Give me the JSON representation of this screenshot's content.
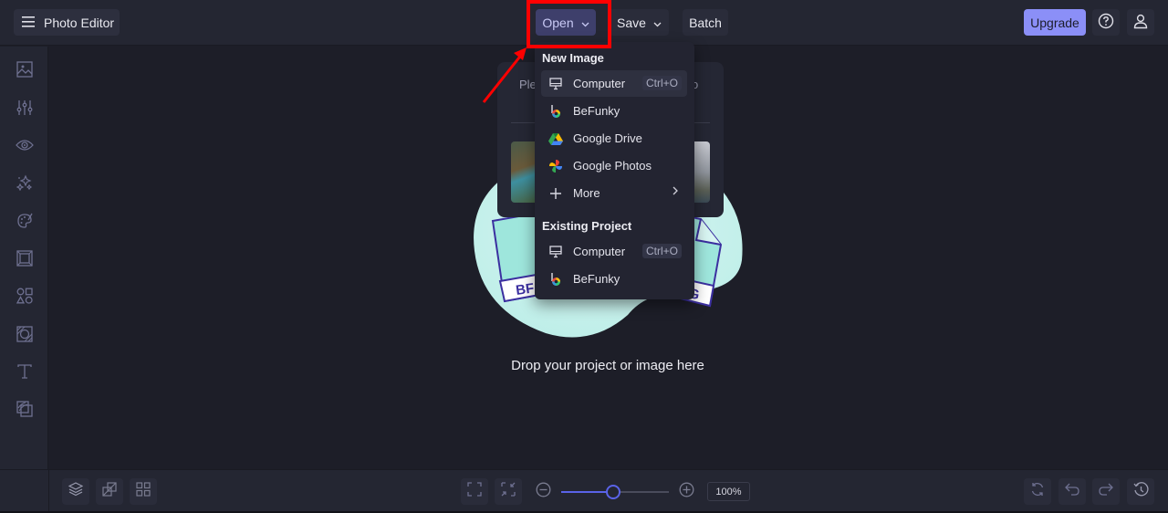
{
  "topbar": {
    "app_title": "Photo Editor",
    "menu_icon": "hamburger-icon",
    "open_label": "Open",
    "save_label": "Save",
    "batch_label": "Batch",
    "upgrade_label": "Upgrade",
    "help_icon": "help-icon",
    "user_icon": "user-icon"
  },
  "sidebar": {
    "items": [
      {
        "name": "image-manager",
        "icon": "image-icon"
      },
      {
        "name": "edit",
        "icon": "sliders-icon"
      },
      {
        "name": "touch-up",
        "icon": "eye-icon"
      },
      {
        "name": "effects",
        "icon": "sparkles-icon"
      },
      {
        "name": "artsy",
        "icon": "palette-icon"
      },
      {
        "name": "frames",
        "icon": "frame-icon"
      },
      {
        "name": "graphics",
        "icon": "shapes-icon"
      },
      {
        "name": "overlays",
        "icon": "overlay-icon"
      },
      {
        "name": "text",
        "icon": "text-icon"
      },
      {
        "name": "textures",
        "icon": "textures-icon"
      }
    ]
  },
  "card": {
    "text_left": "Ple",
    "text_right": "o"
  },
  "dropdown": {
    "sections": [
      {
        "header": "New Image",
        "items": [
          {
            "label": "Computer",
            "icon": "monitor-icon",
            "shortcut": "Ctrl+O"
          },
          {
            "label": "BeFunky",
            "icon": "befunky-icon"
          },
          {
            "label": "Google Drive",
            "icon": "google-drive-icon"
          },
          {
            "label": "Google Photos",
            "icon": "google-photos-icon"
          },
          {
            "label": "More",
            "icon": "plus-icon",
            "submenu": true
          }
        ]
      },
      {
        "header": "Existing Project",
        "items": [
          {
            "label": "Computer",
            "icon": "monitor-icon",
            "shortcut": "Ctrl+O"
          },
          {
            "label": "BeFunky",
            "icon": "befunky-icon"
          }
        ]
      }
    ]
  },
  "canvas": {
    "drop_text": "Drop your project or image here",
    "illustration_left_label": "BF",
    "illustration_right_label": "G"
  },
  "bottombar": {
    "zoom_value": "100%",
    "zoom_level_fraction": 0.48
  },
  "colors": {
    "accent": "#8b8ff7",
    "open_active_bg": "#3e3f6b",
    "slider": "#5a63e8",
    "annotation": "#ff0000"
  }
}
